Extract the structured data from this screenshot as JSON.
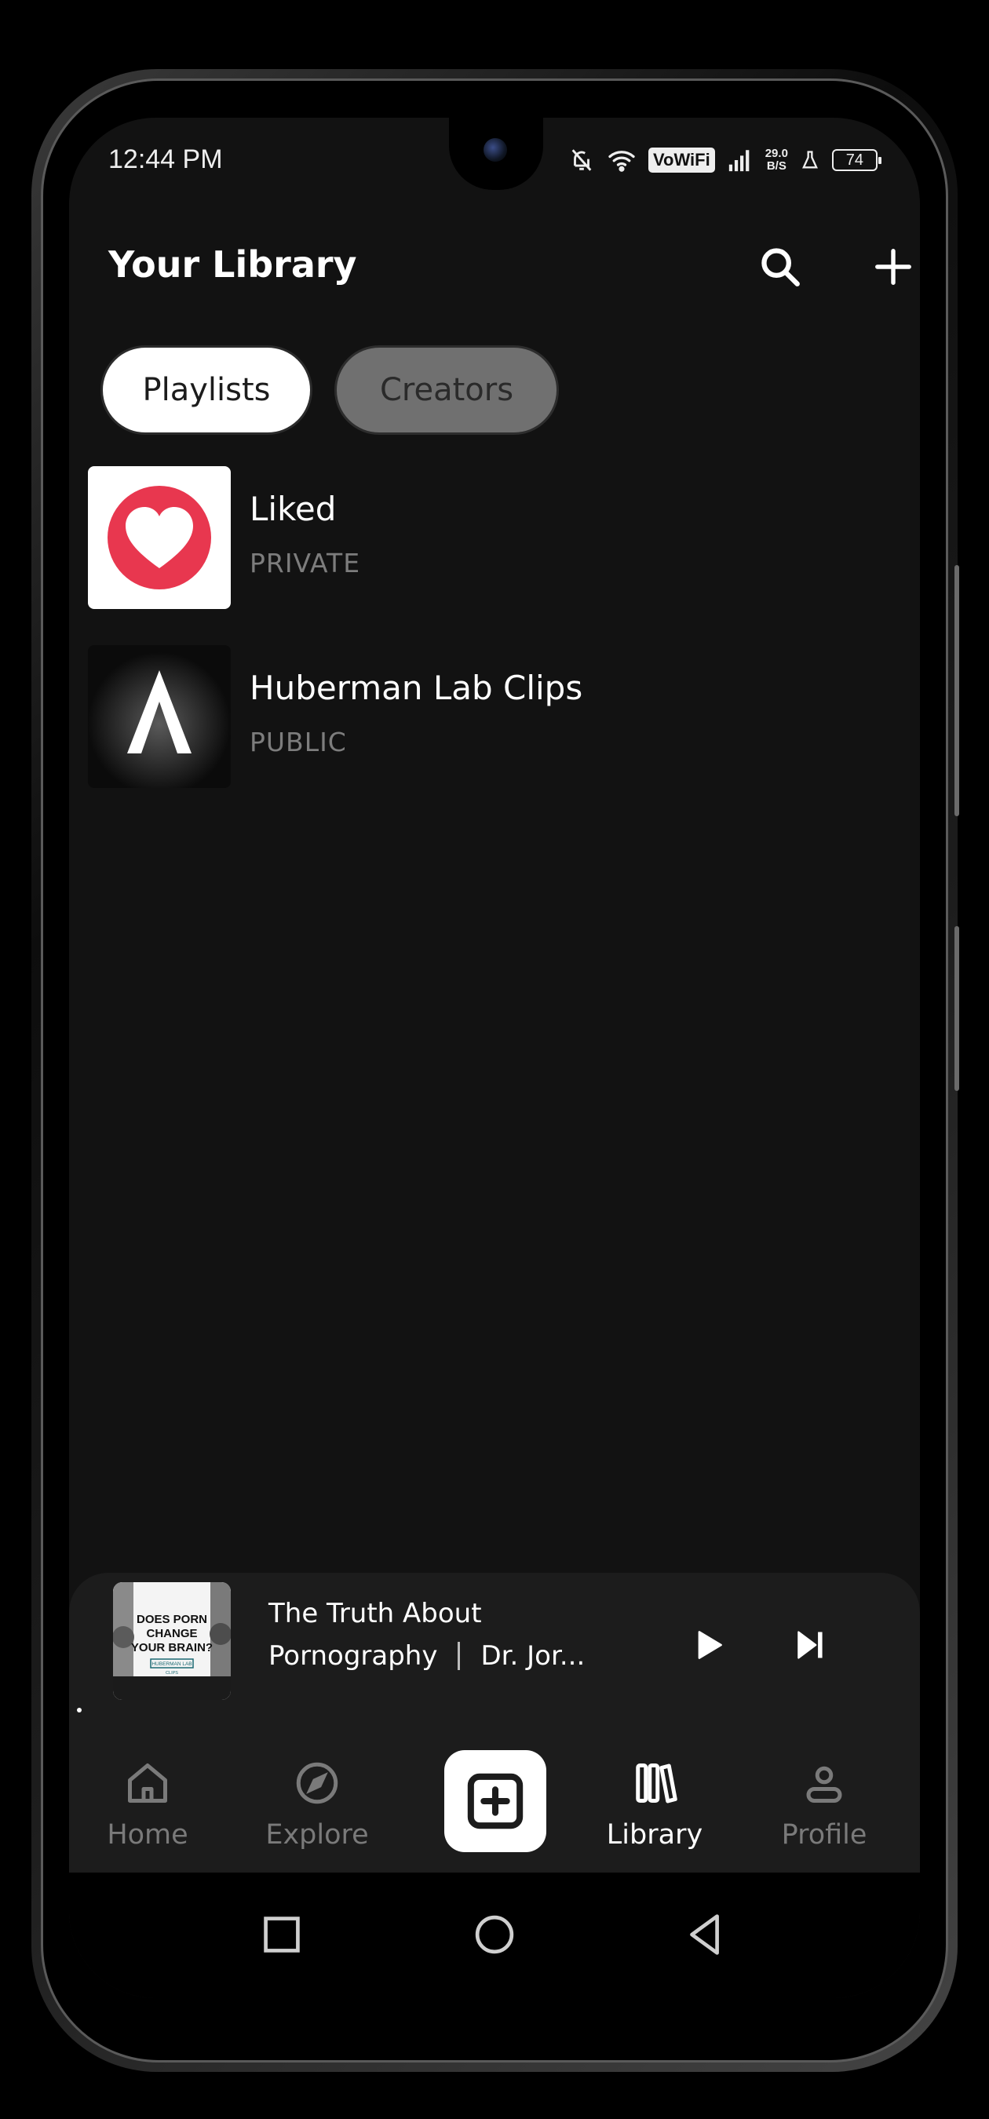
{
  "status_bar": {
    "time": "12:44 PM",
    "vowifi": "VoWiFi",
    "net_speed_value": "29.0",
    "net_speed_unit": "B/S",
    "battery": "74"
  },
  "header": {
    "title": "Your Library"
  },
  "filters": {
    "playlists": "Playlists",
    "creators": "Creators"
  },
  "library_items": [
    {
      "title": "Liked",
      "visibility": "PRIVATE",
      "icon": "heart-icon"
    },
    {
      "title": "Huberman Lab Clips",
      "visibility": "PUBLIC",
      "icon": "huberman-logo"
    }
  ],
  "now_playing": {
    "art_text_line1": "DOES PORN",
    "art_text_line2": "CHANGE",
    "art_text_line3": "YOUR BRAIN?",
    "art_badge": "HUBERMAN LAB",
    "art_badge_sub": "CLIPS",
    "title_line1": "The Truth About",
    "title_line2": "Pornography",
    "artist": "Dr. Jor..."
  },
  "bottom_nav": {
    "home": "Home",
    "explore": "Explore",
    "library": "Library",
    "profile": "Profile",
    "active": "library"
  },
  "colors": {
    "background": "#121212",
    "surface": "#1c1c1c",
    "liked_red": "#e8374f",
    "inactive_text": "#7a7a7a"
  }
}
